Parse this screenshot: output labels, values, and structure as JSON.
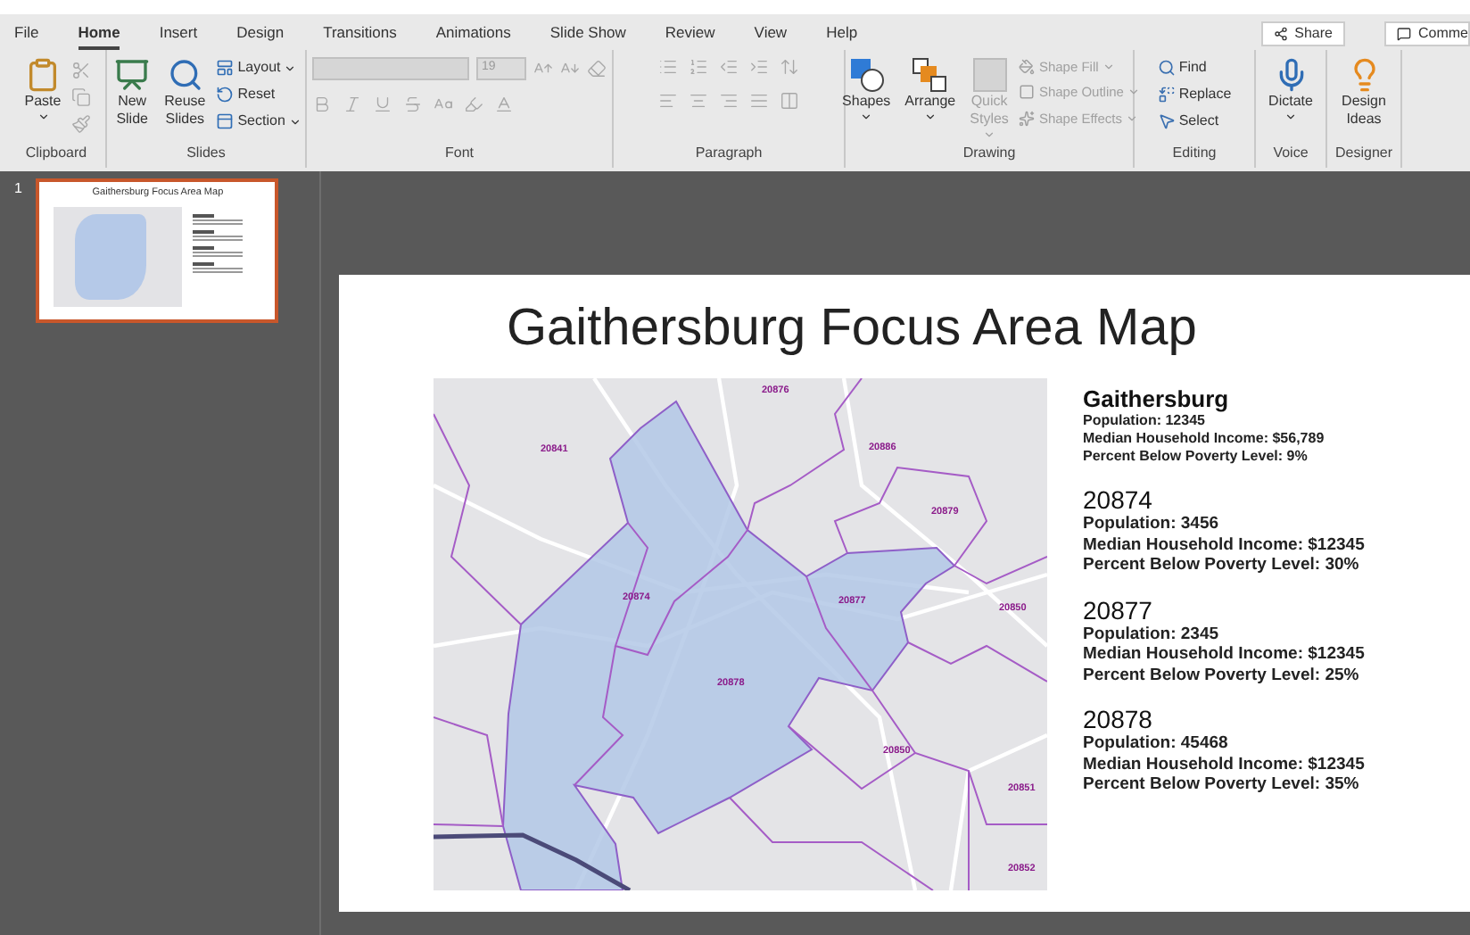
{
  "menu_tabs": [
    {
      "label": "File",
      "selected": false
    },
    {
      "label": "Home",
      "selected": true
    },
    {
      "label": "Insert",
      "selected": false
    },
    {
      "label": "Design",
      "selected": false
    },
    {
      "label": "Transitions",
      "selected": false
    },
    {
      "label": "Animations",
      "selected": false
    },
    {
      "label": "Slide Show",
      "selected": false
    },
    {
      "label": "Review",
      "selected": false
    },
    {
      "label": "View",
      "selected": false
    },
    {
      "label": "Help",
      "selected": false
    }
  ],
  "share_button": {
    "label": "Share"
  },
  "comments_button": {
    "label": "Comme"
  },
  "ribbon": {
    "clipboard": {
      "label": "Clipboard",
      "paste": "Paste"
    },
    "slides": {
      "label": "Slides",
      "new_slide": [
        "New",
        "Slide"
      ],
      "reuse_slides": [
        "Reuse",
        "Slides"
      ],
      "small": [
        {
          "label": "Layout",
          "dropdown": true
        },
        {
          "label": "Reset",
          "dropdown": false
        },
        {
          "label": "Section",
          "dropdown": true
        }
      ]
    },
    "font": {
      "label": "Font",
      "font_size": "19",
      "disabled": true
    },
    "paragraph": {
      "label": "Paragraph",
      "disabled": true
    },
    "drawing": {
      "label": "Drawing",
      "big": [
        {
          "label": [
            "Shapes"
          ],
          "disabled": false
        },
        {
          "label": [
            "Arrange"
          ],
          "disabled": false
        },
        {
          "label": [
            "Quick",
            "Styles"
          ],
          "disabled": true
        }
      ],
      "small": [
        {
          "label": "Shape Fill",
          "disabled": true
        },
        {
          "label": "Shape Outline",
          "disabled": true
        },
        {
          "label": "Shape Effects",
          "disabled": true
        }
      ]
    },
    "editing": {
      "label": "Editing",
      "items": [
        {
          "label": "Find"
        },
        {
          "label": "Replace"
        },
        {
          "label": "Select"
        }
      ]
    },
    "voice": {
      "label": "Voice",
      "dictate": "Dictate"
    },
    "designer": {
      "label": "Designer",
      "design_ideas": [
        "Design",
        "Ideas"
      ]
    }
  },
  "thumbnail": {
    "number": "1",
    "title": "Gaithersburg Focus Area Map",
    "selected": true
  },
  "slide": {
    "title": "Gaithersburg Focus Area Map",
    "map_labels": [
      "20876",
      "20841",
      "20886",
      "20879",
      "20874",
      "20877",
      "20850",
      "20878",
      "20850",
      "20851",
      "20852"
    ],
    "stats": [
      {
        "heading": "Gaithersburg",
        "lines": [
          "Population: 12345",
          "Median Household Income: $56,789",
          "Percent Below Poverty Level: 9%"
        ]
      },
      {
        "heading": "20874",
        "lines": [
          "Population: 3456",
          "Median Household Income: $12345",
          "Percent Below Poverty Level: 30%"
        ]
      },
      {
        "heading": "20877",
        "lines": [
          "Population: 2345",
          "Median Household Income: $12345",
          "Percent Below Poverty Level: 25%"
        ]
      },
      {
        "heading": "20878",
        "lines": [
          "Population: 45468",
          "Median Household Income: $12345",
          "Percent Below Poverty Level: 35%"
        ]
      }
    ]
  }
}
